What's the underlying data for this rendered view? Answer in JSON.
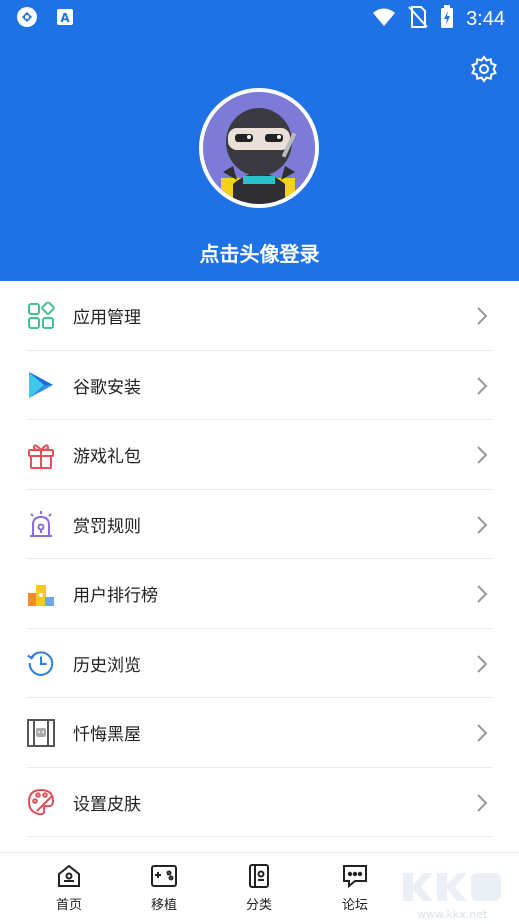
{
  "status": {
    "time": "3:44"
  },
  "header": {
    "login_text": "点击头像登录",
    "bg_color": "#1f72e6"
  },
  "menu": [
    {
      "label": "应用管理",
      "icon": "apps-grid-icon"
    },
    {
      "label": "谷歌安装",
      "icon": "google-play-icon"
    },
    {
      "label": "游戏礼包",
      "icon": "gift-icon"
    },
    {
      "label": "赏罚规则",
      "icon": "alarm-light-icon"
    },
    {
      "label": "用户排行榜",
      "icon": "ranking-icon"
    },
    {
      "label": "历史浏览",
      "icon": "history-icon"
    },
    {
      "label": "忏悔黑屋",
      "icon": "jail-icon"
    },
    {
      "label": "设置皮肤",
      "icon": "palette-icon"
    }
  ],
  "tabs": [
    {
      "label": "首页",
      "icon": "home-icon"
    },
    {
      "label": "移植",
      "icon": "gamepad-icon"
    },
    {
      "label": "分类",
      "icon": "category-book-icon"
    },
    {
      "label": "论坛",
      "icon": "forum-icon"
    }
  ],
  "watermark": {
    "text": "www.kkx.net"
  }
}
